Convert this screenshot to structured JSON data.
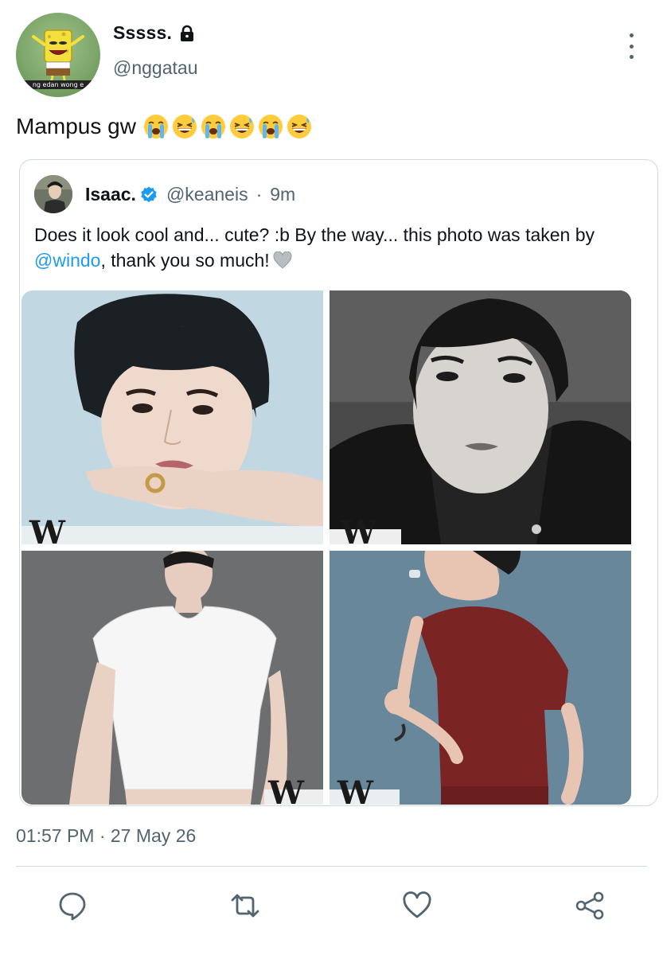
{
  "tweet": {
    "author": {
      "display_name": "Sssss.",
      "handle": "@nggatau",
      "avatar_caption": "ng edan wong e"
    },
    "text": "Mampus gw",
    "emojis": [
      "loudly-crying-face",
      "grinning-squinting-face-sweat",
      "loudly-crying-face",
      "grinning-squinting-face-sweat",
      "loudly-crying-face",
      "grinning-squinting-face-sweat"
    ],
    "timestamp": "01:57 PM · 27 May 26"
  },
  "quote": {
    "display_name": "Isaac.",
    "handle": "@keaneis",
    "separator": "·",
    "time": "9m",
    "text_before_link": "Does it look cool and... cute? :b By the way... this photo was taken by ",
    "link": "@windo",
    "text_after_link": ", thank you so much!",
    "photos": [
      {
        "name": "photo-1",
        "magazine_mark": "W"
      },
      {
        "name": "photo-2",
        "magazine_mark": "W"
      },
      {
        "name": "photo-3",
        "magazine_mark": "W"
      },
      {
        "name": "photo-4",
        "magazine_mark": "W"
      }
    ]
  },
  "actions": [
    "reply-icon",
    "retweet-icon",
    "like-icon",
    "share-icon"
  ],
  "colors": {
    "text": "#0f1419",
    "secondary": "#536471",
    "link": "#1d9bf0",
    "border": "#cfd9de"
  }
}
